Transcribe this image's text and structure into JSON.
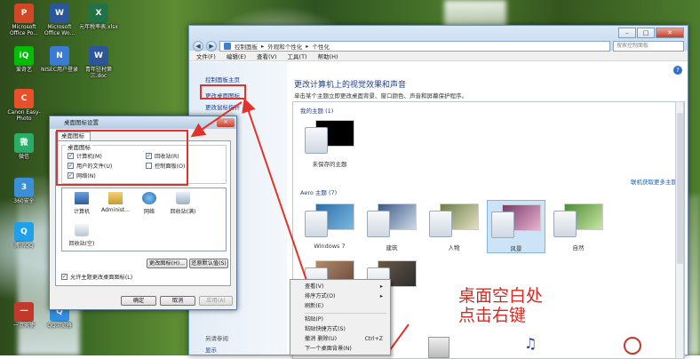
{
  "desktop": {
    "icons": [
      {
        "label": "Microsoft Office Po...",
        "color": "#d24726",
        "glyph": "P"
      },
      {
        "label": "Microsoft Office Wo...",
        "color": "#2b579a",
        "glyph": "W"
      },
      {
        "label": "元年税率表.xlsx",
        "color": "#217346",
        "glyph": "X"
      },
      {
        "label": "爱奇艺",
        "color": "#00be06",
        "glyph": "iQ"
      },
      {
        "label": "NISEC用户登录",
        "color": "#3a7bd5",
        "glyph": "N"
      },
      {
        "label": "青年驻村第三.doc",
        "color": "#2b579a",
        "glyph": "W"
      },
      {
        "label": "Canon Easy-Photo",
        "color": "#e8502b",
        "glyph": "C"
      },
      {
        "label": "微信",
        "color": "#2aae67",
        "glyph": "微"
      },
      {
        "label": "360安全",
        "color": "#3b8fd8",
        "glyph": "3"
      },
      {
        "label": "腾讯QQ",
        "color": "#1ea1e8",
        "glyph": "Q"
      },
      {
        "label": "一点天使",
        "color": "#c0392b",
        "glyph": "一"
      },
      {
        "label": "QQ浏览器",
        "color": "#2f8fe0",
        "glyph": "Q"
      }
    ]
  },
  "control_panel": {
    "nav": {
      "back": "◀",
      "forward": "▶",
      "breadcrumb": [
        "控制面板",
        "外观和个性化",
        "个性化"
      ],
      "search_placeholder": "搜索控制面板"
    },
    "menu": [
      "文件(F)",
      "编辑(E)",
      "查看(V)",
      "工具(T)",
      "帮助(H)"
    ],
    "left_links": [
      "控制面板主页",
      "更改桌面图标",
      "更改鼠标指针"
    ],
    "left_see_also_label": "另请参阅",
    "left_see_also_first": "显示",
    "heading": "更改计算机上的视觉效果和声音",
    "subheading": "单击某个主题立即更改桌面背景、窗口颜色、声音和屏幕保护程序。",
    "my_themes_label": "我的主题 (1)",
    "unsaved_theme": "未保存的主题",
    "online_link": "联机获取更多主题",
    "aero_label": "Aero 主题 (7)",
    "aero_themes": [
      {
        "name": "Windows 7"
      },
      {
        "name": "建筑"
      },
      {
        "name": "人物"
      },
      {
        "name": "风景"
      },
      {
        "name": "自然"
      }
    ]
  },
  "dialog": {
    "title": "桌面图标设置",
    "tab": "桌面图标",
    "group_label": "桌面图标",
    "checkboxes": [
      {
        "label": "计算机(M)",
        "checked": "✓"
      },
      {
        "label": "回收站(R)",
        "checked": "✓"
      },
      {
        "label": "用户的文件(U)",
        "checked": "✓"
      },
      {
        "label": "控制面板(O)",
        "checked": ""
      },
      {
        "label": "网络(N)",
        "checked": "✓"
      }
    ],
    "icons": [
      "计算机",
      "Administ...",
      "网络",
      "回收站(满)",
      "回收站(空)"
    ],
    "change_icon_btn": "更改图标(H)...",
    "restore_btn": "还原默认值(S)",
    "allow_themes": "允许主题更改桌面图标(L)",
    "ok": "确定",
    "cancel": "取消",
    "apply": "应用(A)"
  },
  "context_menu": {
    "items": [
      {
        "label": "查看(V)",
        "shortcut": "▸"
      },
      {
        "label": "排序方式(O)",
        "shortcut": "▸"
      },
      {
        "label": "刷新(E)",
        "shortcut": ""
      },
      {
        "label": "粘贴(P)",
        "shortcut": ""
      },
      {
        "label": "粘贴快捷方式(S)",
        "shortcut": ""
      },
      {
        "label": "撤消 删除(U)",
        "shortcut": "Ctrl+Z"
      },
      {
        "label": "下一个桌面背景(N)",
        "shortcut": ""
      }
    ]
  },
  "annotation": {
    "line1": "桌面空白处",
    "line2": "点击右键",
    "color": "#d8281f"
  }
}
